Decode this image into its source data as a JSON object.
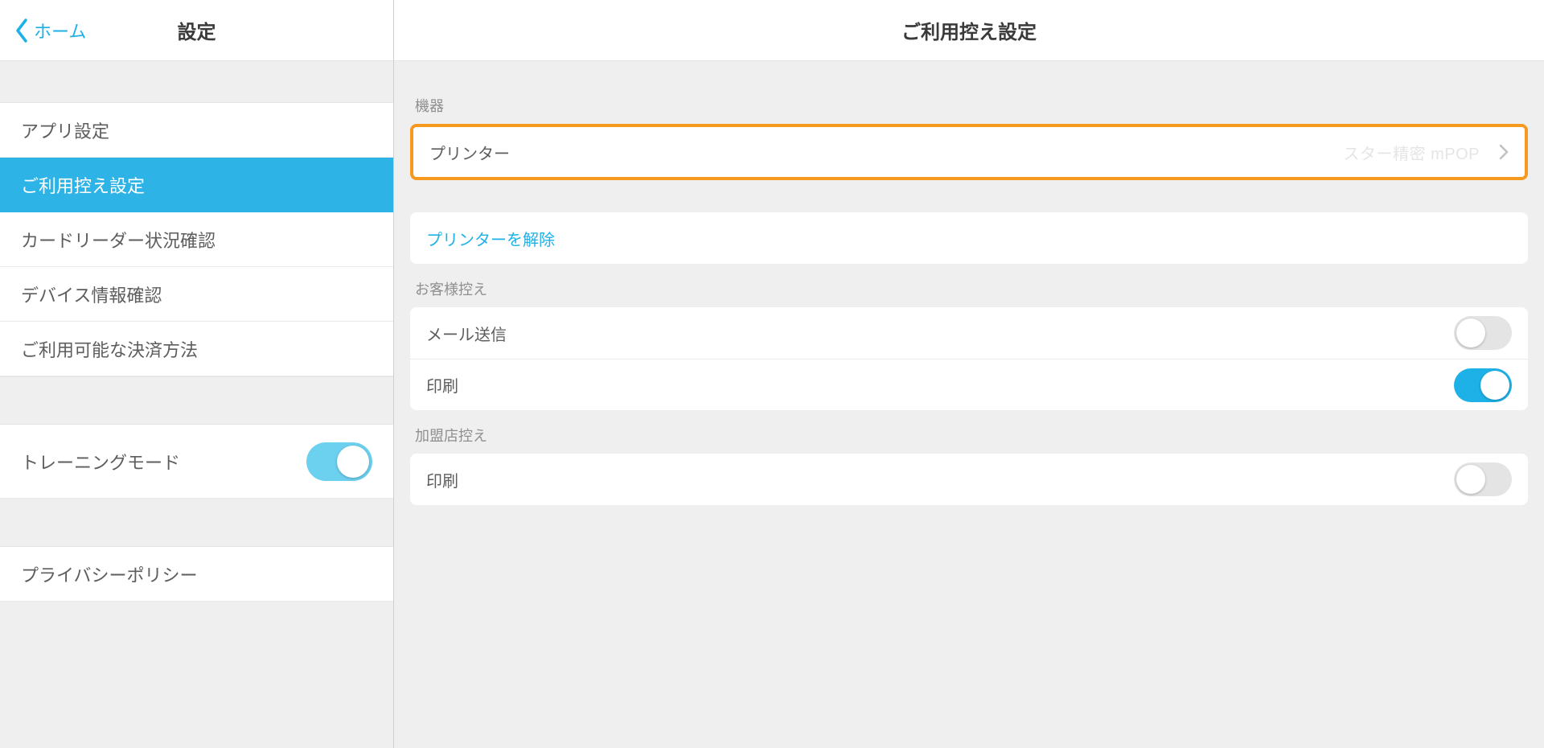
{
  "sidebar": {
    "back_label": "ホーム",
    "title": "設定",
    "items": [
      {
        "key": "app-settings",
        "label": "アプリ設定"
      },
      {
        "key": "receipt-settings",
        "label": "ご利用控え設定"
      },
      {
        "key": "card-reader-status",
        "label": "カードリーダー状況確認"
      },
      {
        "key": "device-info",
        "label": "デバイス情報確認"
      },
      {
        "key": "payment-methods",
        "label": "ご利用可能な決済方法"
      }
    ],
    "selected_key": "receipt-settings",
    "training_mode": {
      "label": "トレーニングモード",
      "on": true
    },
    "privacy_policy_label": "プライバシーポリシー"
  },
  "main": {
    "title": "ご利用控え設定",
    "sections": {
      "device": {
        "label": "機器",
        "printer_row_label": "プリンター",
        "printer_value": "スター精密 mPOP",
        "unlink_printer_label": "プリンターを解除"
      },
      "customer_copy": {
        "label": "お客様控え",
        "rows": {
          "email": {
            "label": "メール送信",
            "on": false
          },
          "print": {
            "label": "印刷",
            "on": true
          }
        }
      },
      "merchant_copy": {
        "label": "加盟店控え",
        "rows": {
          "print": {
            "label": "印刷",
            "on": false
          }
        }
      }
    }
  },
  "colors": {
    "accent": "#1eb1e7",
    "accent_light": "#6cd0ef",
    "highlight": "#f59a1f"
  }
}
